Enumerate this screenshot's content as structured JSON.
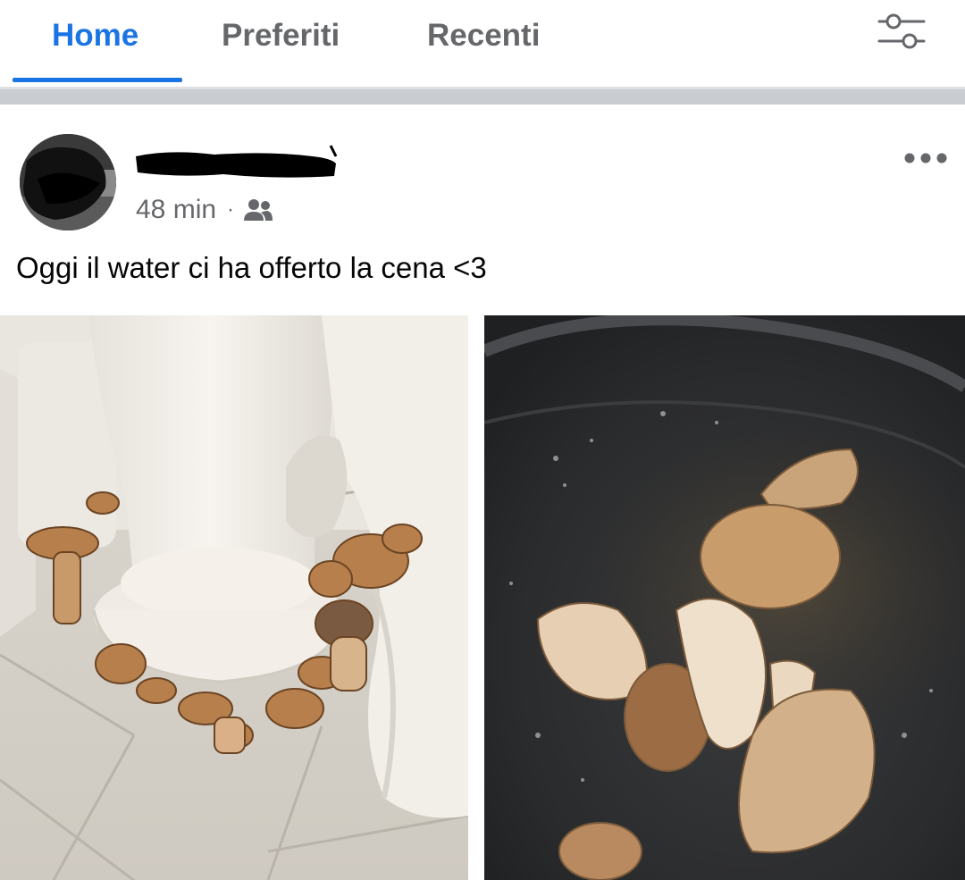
{
  "tabs": [
    {
      "label": "Home",
      "active": true
    },
    {
      "label": "Preferiti",
      "active": false
    },
    {
      "label": "Recenti",
      "active": false
    }
  ],
  "colors": {
    "accent": "#1b74e4",
    "secondary_text": "#65676b",
    "primary_text": "#050505",
    "separator": "#c9ccd1"
  },
  "icons": {
    "filter": "sliders-icon",
    "more": "more-horizontal-icon",
    "audience": "friends-icon"
  },
  "post": {
    "author": {
      "name": "",
      "redacted": true
    },
    "timestamp": "48 min",
    "separator": "·",
    "audience": "friends",
    "text": "Oggi il water ci ha offerto la cena <3",
    "photos": [
      {
        "subject": "toilet-base-with-mushrooms"
      },
      {
        "subject": "pan-with-fried-mushrooms"
      }
    ]
  }
}
